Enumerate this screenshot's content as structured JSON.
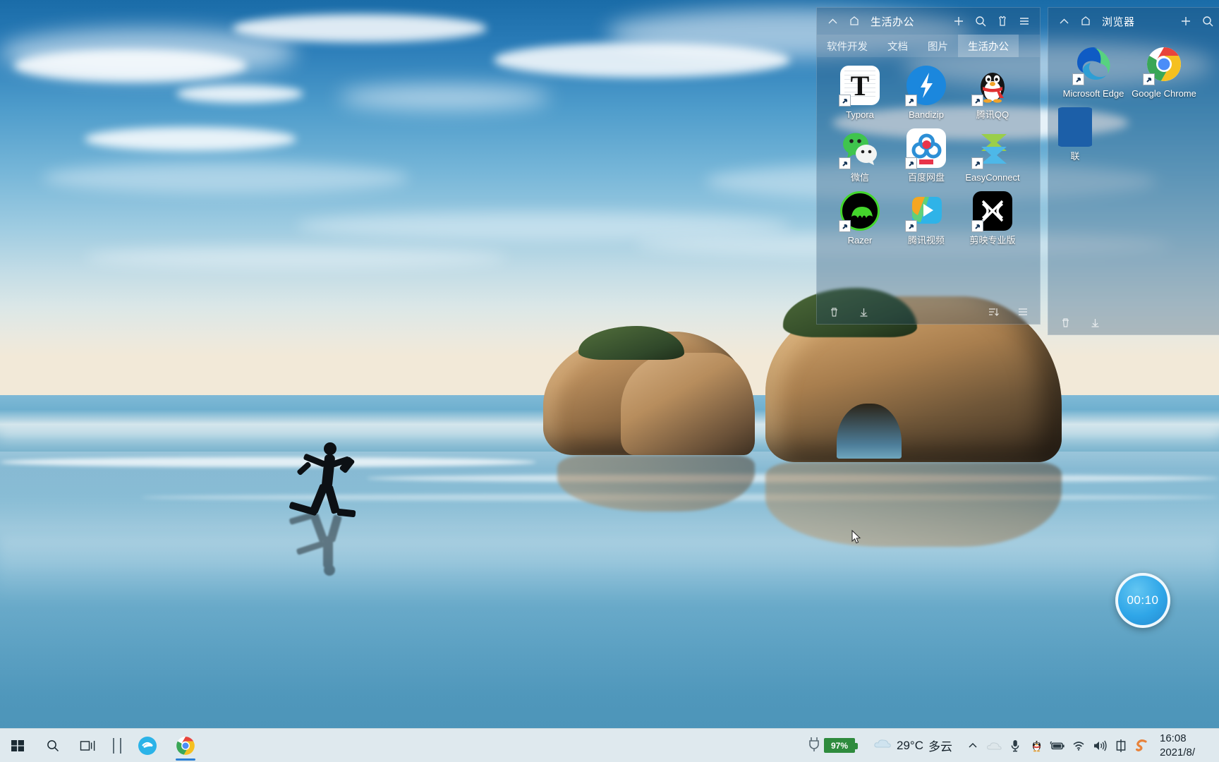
{
  "desktop": {
    "wallpaper_name": "windows-10-beach-rocks-runner",
    "timer": {
      "value": "00:10",
      "name": "countdown-timer"
    }
  },
  "panels": [
    {
      "id": "life-office",
      "title": "生活办公",
      "head_icons": [
        "collapse-chevron-icon",
        "pin-icon"
      ],
      "action_icons": [
        "plus-icon",
        "search-icon",
        "skin-icon",
        "menu-icon"
      ],
      "tabs": [
        {
          "label": "软件开发",
          "active": false
        },
        {
          "label": "文档",
          "active": false
        },
        {
          "label": "图片",
          "active": false
        },
        {
          "label": "生活办公",
          "active": true
        }
      ],
      "items": [
        {
          "label": "Typora",
          "icon": "typora-icon"
        },
        {
          "label": "Bandizip",
          "icon": "bandizip-icon"
        },
        {
          "label": "腾讯QQ",
          "icon": "tencent-qq-icon"
        },
        {
          "label": "微信",
          "icon": "wechat-icon"
        },
        {
          "label": "百度网盘",
          "icon": "baidu-netdisk-icon"
        },
        {
          "label": "EasyConnect",
          "icon": "easyconnect-icon"
        },
        {
          "label": "Razer",
          "icon": "razer-icon"
        },
        {
          "label": "腾讯视频",
          "icon": "tencent-video-icon"
        },
        {
          "label": "剪映专业版",
          "icon": "jianying-icon"
        }
      ],
      "footer_icons": [
        "trash-icon",
        "download-icon",
        "sort-icon",
        "list-view-icon"
      ]
    },
    {
      "id": "browser",
      "title": "浏览器",
      "head_icons": [
        "collapse-chevron-icon",
        "pin-icon"
      ],
      "action_icons": [
        "plus-icon",
        "search-icon"
      ],
      "items": [
        {
          "label": "Microsoft Edge",
          "icon": "microsoft-edge-icon"
        },
        {
          "label": "Google Chrome",
          "icon": "google-chrome-icon"
        },
        {
          "label": "联",
          "icon": "cut-off-icon"
        }
      ],
      "footer_icons": [
        "trash-icon",
        "download-icon"
      ]
    }
  ],
  "taskbar": {
    "start_icon": "windows-start-icon",
    "search_icon": "search-icon",
    "taskview_icon": "task-view-icon",
    "separator_icon": "divider-icon",
    "apps": [
      {
        "name": "360-browser",
        "icon": "360-browser-icon",
        "running": false
      },
      {
        "name": "google-chrome",
        "icon": "google-chrome-icon",
        "running": true
      }
    ],
    "battery_percent": "97%",
    "battery_icon": "plug-battery-icon",
    "weather": {
      "temp": "29°C",
      "condition": "多云",
      "icon": "cloudy-icon"
    },
    "tray_icons": [
      "chevron-up-icon",
      "onedrive-cloud-icon",
      "microphone-icon",
      "qq-penguin-icon",
      "battery-icon",
      "wifi-icon",
      "volume-icon",
      "ime-chinese-icon",
      "sogou-input-icon"
    ],
    "clock": {
      "time": "16:08",
      "date": "2021/8/"
    }
  }
}
